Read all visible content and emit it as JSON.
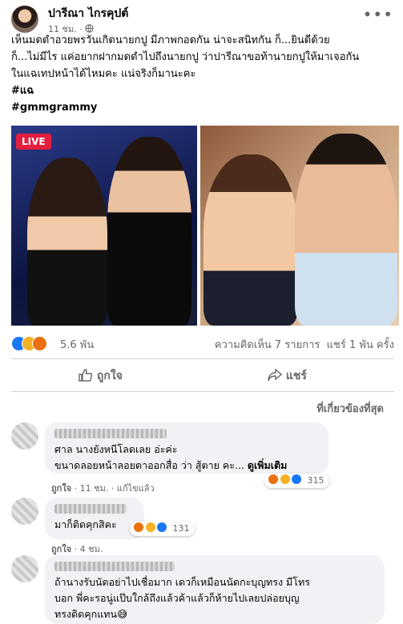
{
  "post": {
    "author": "ปารีณา ไกรคุปต์",
    "time": "11 ชม.",
    "privacy_icon": "globe-icon",
    "more_icon": "more-icon",
    "more_glyph": "•••",
    "lines": [
      "เห็นมดดำอวยพรวันเกิดนายกปู มีภาพกอดกัน น่าจะสนิทกัน ก็...ยินดีด้วย",
      "ก็...ไม่มีไร แค่อยากฝากมดดำไปถึงนายกปู ว่าปารีณาขอท้านายกปูให้มาเจอกัน",
      "ในแฉเทปหน้าได้ไหมคะ แน่จริงก็มานะคะ"
    ],
    "hashtags": [
      "#แฉ",
      "#gmmgrammy"
    ],
    "live_badge": "LIVE",
    "reaction_count": "5.6 พัน",
    "comments_count": "ความคิดเห็น 7 รายการ",
    "shares_count": "แชร์ 1 พัน ครั้ง",
    "like_label": "ถูกใจ",
    "share_label": "แชร์",
    "sort_label": "ที่เกี่ยวข้องที่สุด"
  },
  "comments": [
    {
      "lines": [
        "ศาล นางยังหนีโลดเลย อ่ะค่ะ",
        "ขนาดลอยหน้าลอยตาออกสื่อ ว่า สู้ตาย คะ..."
      ],
      "see_more": "ดูเพิ่มเติม",
      "reactions": "315",
      "like": "ถูกใจ",
      "time": "11 ชม.",
      "edited": "แก้ไขแล้ว"
    },
    {
      "lines": [
        "มาก็ติดคุกสิคะ"
      ],
      "reactions": "131",
      "like": "ถูกใจ",
      "time": "4 ชม."
    },
    {
      "lines": [
        "ถ้านางรับนัดอย่าไปเชื่อมาก เดวก็เหมือนนัดกะบุญทรง มีโทร",
        "บอก พี่คะรอนู่แป๊บใกล้ถึงแล้วค้าแล้วก็ห้ายไปเลยปล่อยบุญ",
        "ทรงติดคุกแทน😅"
      ]
    }
  ],
  "colors": {
    "accent": "#1877f2",
    "like_blue": "#1877f2",
    "haha": "#f7b125",
    "angry": "#e9710f",
    "live_red": "#e41e3f"
  }
}
